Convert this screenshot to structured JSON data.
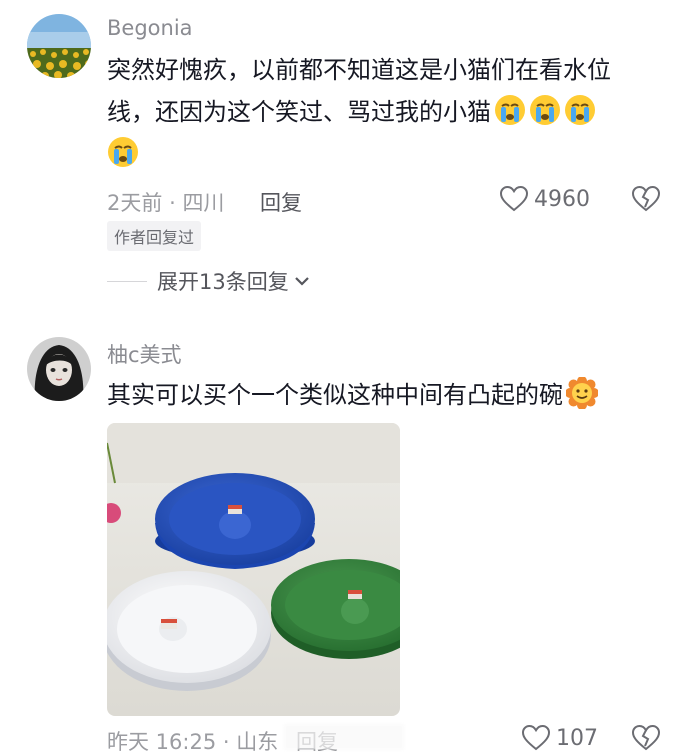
{
  "comments": [
    {
      "username": "Begonia",
      "text": "突然好愧疚，以前都不知道这是小猫们在看水位线，还因为这个笑过、骂过我的小猫",
      "emojis": [
        "crying-face",
        "crying-face",
        "crying-face",
        "crying-face"
      ],
      "time": "2天前",
      "separator": "·",
      "location": "四川",
      "reply_label": "回复",
      "likes": "4960",
      "badge": "作者回复过",
      "expand_label": "展开13条回复"
    },
    {
      "username": "柚c美式",
      "text": "其实可以买个一个类似这种中间有凸起的碗",
      "emojis": [
        "sunflower-face"
      ],
      "time": "昨天 16:25",
      "separator": "·",
      "location": "山东",
      "reply_label": "回复",
      "likes": "107"
    }
  ],
  "colors": {
    "text_primary": "#161823",
    "text_secondary": "#8a8b91",
    "meta": "#9b9ca1",
    "bowl_blue": "#1f49b8",
    "bowl_green": "#2f7d3a",
    "bowl_white": "#f2f3f5"
  }
}
